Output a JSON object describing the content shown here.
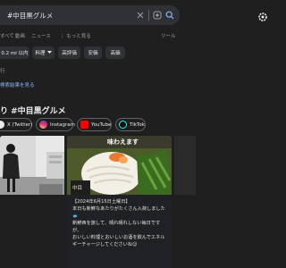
{
  "search": {
    "query": "#中目黒グルメ"
  },
  "tabs": [
    "すべて",
    "動画",
    "ニュース",
    "もっと見る",
    "ツール"
  ],
  "chips": [
    "0.2 mi 以内",
    "料理",
    "高評価",
    "安価",
    "高価"
  ],
  "location_note": "行",
  "update_link": "検索結果を見る",
  "section_title": "り #中目黒グルメ",
  "social": [
    "X (Twitter)",
    "Instagram",
    "YouTube",
    "TikTok"
  ],
  "card2": {
    "overlay": "味わえます",
    "logo": "中目",
    "lines": [
      "【2024年6月15日土曜日】",
      "本日も新鮮なあたりがたくさん入荷しました🐟",
      "新鮮西を旅して、晴れ晴れしない毎日ですが、",
      "おいしい料理とおいしいお酒を飲んでエネル",
      "ギーチャージしてくださいね😊"
    ]
  },
  "colors": {
    "background": "#1f1f1f",
    "link": "#8ab4f8",
    "chip": "#303134"
  }
}
